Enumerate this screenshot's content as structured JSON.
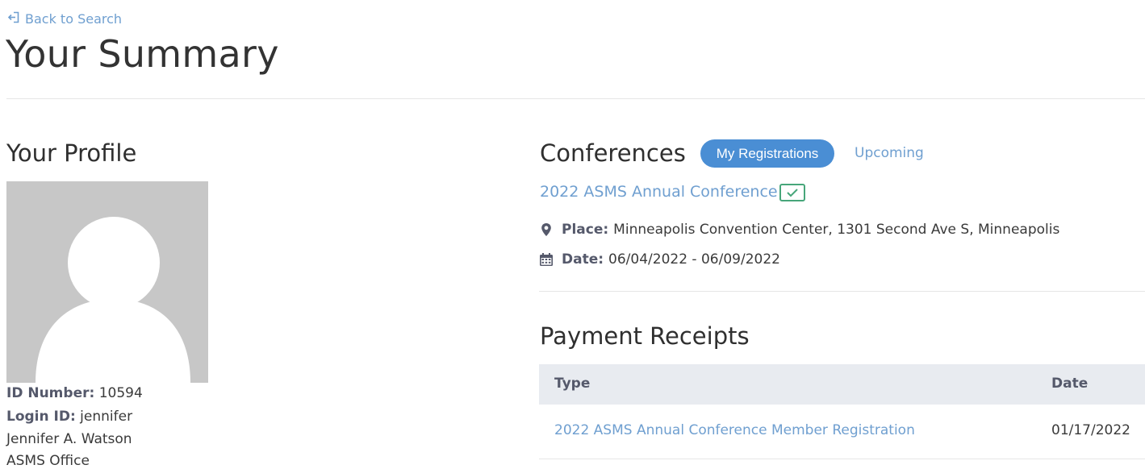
{
  "nav": {
    "back_label": "Back to Search"
  },
  "page": {
    "title": "Your Summary"
  },
  "profile": {
    "section_title": "Your Profile",
    "id_label": "ID Number:",
    "id_value": "10594",
    "login_label": "Login ID:",
    "login_value": "jennifer",
    "name": "Jennifer A. Watson",
    "office": "ASMS Office"
  },
  "conferences": {
    "section_title": "Conferences",
    "tabs": [
      {
        "label": "My Registrations",
        "active": true
      },
      {
        "label": "Upcoming",
        "active": false
      }
    ],
    "item": {
      "title": "2022 ASMS Annual Conference",
      "registered": true,
      "place_label": "Place:",
      "place_value": "Minneapolis Convention Center, 1301 Second Ave S, Minneapolis",
      "date_label": "Date:",
      "date_value": "06/04/2022 - 06/09/2022"
    }
  },
  "receipts": {
    "section_title": "Payment Receipts",
    "columns": [
      "Type",
      "Date"
    ],
    "rows": [
      {
        "type": "2022 ASMS Annual Conference Member Registration",
        "date": "01/17/2022"
      }
    ]
  },
  "colors": {
    "link": "#6f9fd0",
    "accent": "#4a8ed4",
    "success": "#47a67a",
    "table_header_bg": "#e8ebf0"
  },
  "icons": {
    "back": "back-arrow-icon",
    "place": "map-marker-icon",
    "date": "calendar-icon",
    "registered": "check-icon",
    "avatar": "user-placeholder-icon"
  }
}
